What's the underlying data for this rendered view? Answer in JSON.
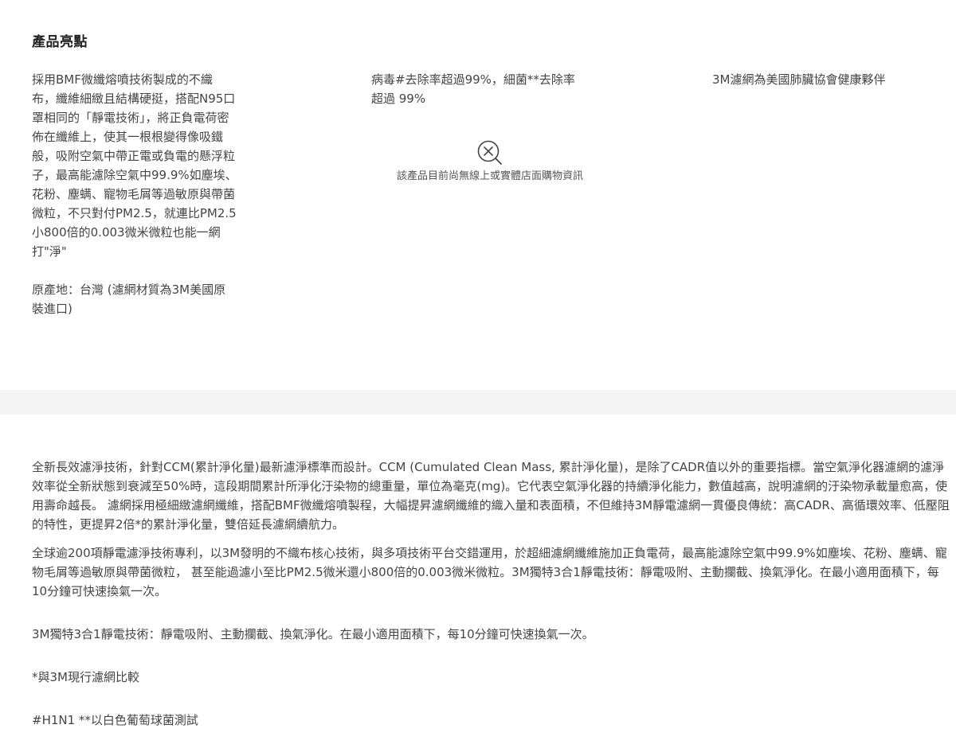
{
  "highlights": {
    "title": "產品亮點",
    "left_description": "採用BMF微纖熔噴技術製成的不織\n布，纖維細緻且結構硬挺，搭配N95口\n罩相同的「靜電技術」，將正負電荷密\n佈在纖維上，使其一根根變得像吸鐵\n般，吸附空氣中帶正電或負電的懸浮粒\n子，最高能濾除空氣中99.9%如塵埃、\n花粉、塵螨、寵物毛屑等過敏原與帶菌\n微粒，不只對付PM2.5，就連比PM2.5\n小800倍的0.003微米微粒也能一網\n打\"淨\"",
    "origin": "原產地：台灣 (濾網材質為3M美國原\n裝進口)",
    "middle_description": "病毒#去除率超過99%，細菌**去除率\n超過 99%",
    "right_description": "3M濾網為美國肺臟協會健康夥伴",
    "unavailable_icon": "no-purchase-info-icon",
    "unavailable_message": "該產品目前尚無線上或實體店面購物資訊"
  },
  "details": {
    "paragraph_1": "全新長效濾淨技術，針對CCM(累計淨化量)最新濾淨標準而設計。CCM (Cumulated Clean Mass, 累計淨化量)，是除了CADR值以外的重要指標。當空氣淨化器濾網的濾淨效率從全新狀態到衰減至50%時，這段期間累計所淨化汙染物的總重量，單位為毫克(mg)。它代表空氣淨化器的持續淨化能力，數值越高，說明濾網的汙染物承載量愈高，使用壽命越長。 濾網採用極細緻濾網纖維，搭配BMF微纖熔噴製程，大幅提昇濾網纖維的織入量和表面積，不但維持3M靜電濾網一貫優良傳統：高CADR、高循環效率、低壓阻的特性，更提昇2倍*的累計淨化量，雙倍延長濾網續航力。",
    "paragraph_2": "全球逾200項靜電濾淨技術專利，以3M發明的不織布核心技術，與多項技術平台交錯運用，於超細濾網纖維施加正負電荷，最高能濾除空氣中99.9%如塵埃、花粉、塵螨、寵物毛屑等過敏原與帶菌微粒， 甚至能過濾小至比PM2.5微米還小800倍的0.003微米微粒。3M獨特3合1靜電技術：靜電吸附、主動攔截、換氣淨化。在最小適用面積下，每10分鐘可快速換氣一次。",
    "paragraph_3": "3M獨特3合1靜電技術：靜電吸附、主動攔截、換氣淨化。在最小適用面積下，每10分鐘可快速換氣一次。",
    "footnote_1": "*與3M現行濾網比較",
    "footnote_2": "#H1N1 **以白色葡萄球菌測試"
  }
}
